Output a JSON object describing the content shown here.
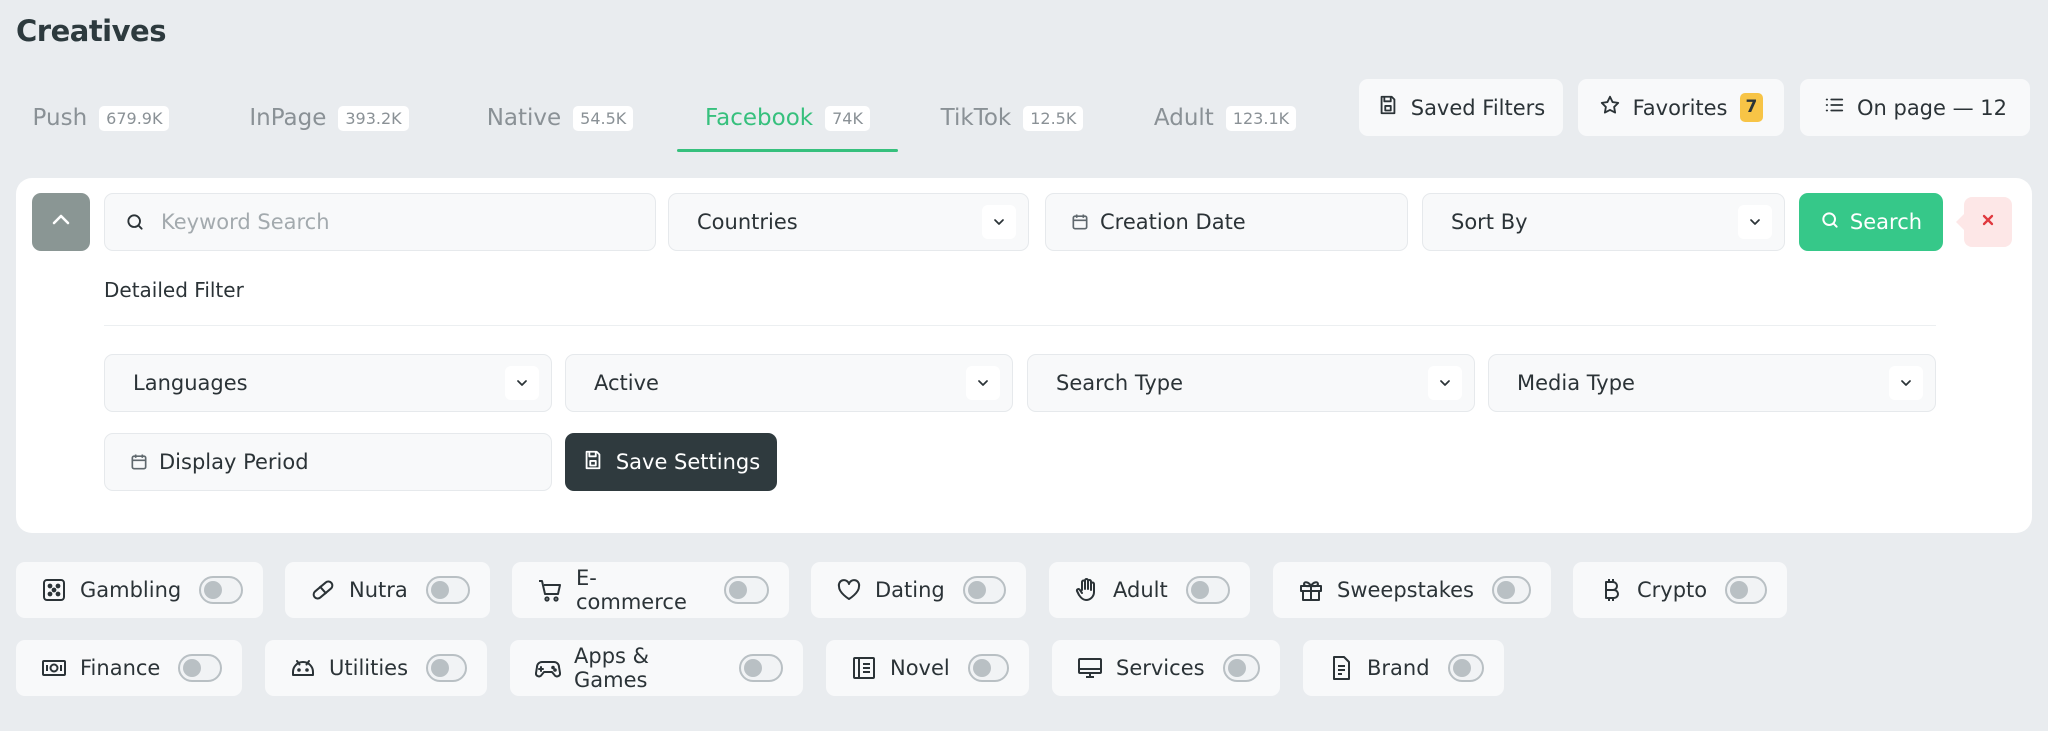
{
  "page": {
    "title": "Creatives"
  },
  "tabs": [
    {
      "label": "Push",
      "count": "679.9K"
    },
    {
      "label": "InPage",
      "count": "393.2K"
    },
    {
      "label": "Native",
      "count": "54.5K"
    },
    {
      "label": "Facebook",
      "count": "74K",
      "active": true
    },
    {
      "label": "TikTok",
      "count": "12.5K"
    },
    {
      "label": "Adult",
      "count": "123.1K"
    }
  ],
  "top_actions": {
    "saved_filters": "Saved Filters",
    "favorites": "Favorites",
    "favorites_count": "7",
    "on_page": "On page — 12"
  },
  "filters": {
    "keyword_placeholder": "Keyword Search",
    "countries": "Countries",
    "creation_date": "Creation Date",
    "sort_by": "Sort By",
    "search_label": "Search",
    "detailed_filter_label": "Detailed Filter",
    "languages": "Languages",
    "active": "Active",
    "search_type": "Search Type",
    "media_type": "Media Type",
    "display_period": "Display Period",
    "save_settings": "Save Settings"
  },
  "categories_row1": [
    {
      "label": "Gambling",
      "icon": "dice-icon"
    },
    {
      "label": "Nutra",
      "icon": "pill-icon"
    },
    {
      "label": "E-commerce",
      "icon": "cart-icon"
    },
    {
      "label": "Dating",
      "icon": "heart-icon"
    },
    {
      "label": "Adult",
      "icon": "hand-icon"
    },
    {
      "label": "Sweepstakes",
      "icon": "gift-icon"
    },
    {
      "label": "Crypto",
      "icon": "bitcoin-icon"
    }
  ],
  "categories_row2": [
    {
      "label": "Finance",
      "icon": "banknote-icon"
    },
    {
      "label": "Utilities",
      "icon": "android-icon"
    },
    {
      "label": "Apps & Games",
      "icon": "gamepad-icon"
    },
    {
      "label": "Novel",
      "icon": "book-icon"
    },
    {
      "label": "Services",
      "icon": "monitor-icon"
    },
    {
      "label": "Brand",
      "icon": "document-icon"
    }
  ],
  "colors": {
    "accent": "#36c07d",
    "dark": "#2f3a3e",
    "badge": "#f7c446",
    "danger": "#e0393e"
  }
}
